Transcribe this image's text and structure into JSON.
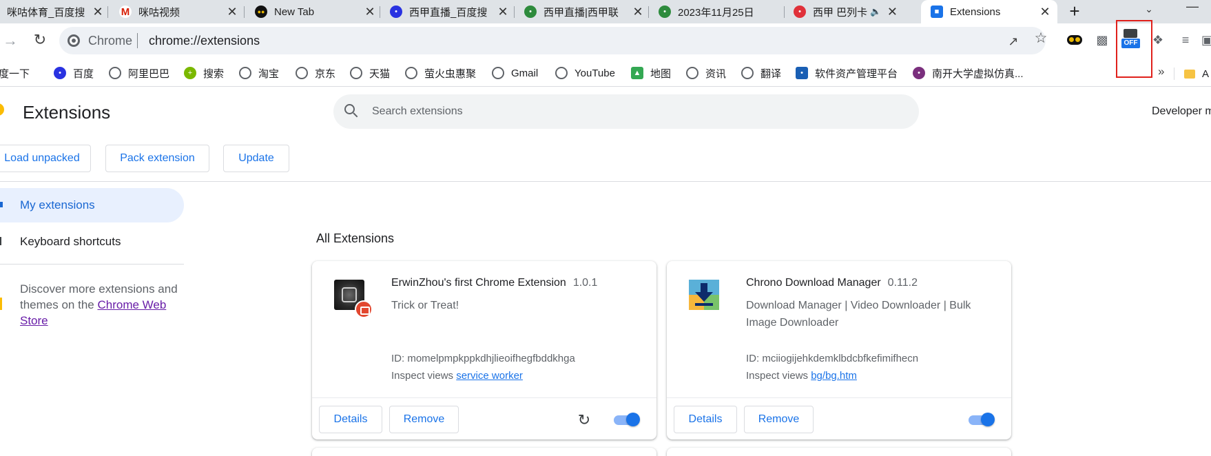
{
  "tabs": [
    {
      "title": "咪咕体育_百度搜",
      "favicon": "baidu-icon",
      "color": "#2932e1",
      "active": false
    },
    {
      "title": "咪咕视频",
      "favicon": "migu-icon",
      "color": "#d81e06",
      "active": false
    },
    {
      "title": "New Tab",
      "favicon": "eyes-icon",
      "color": "#111111",
      "active": false
    },
    {
      "title": "西甲直播_百度搜",
      "favicon": "baidu-icon",
      "color": "#2932e1",
      "active": false
    },
    {
      "title": "西甲直播|西甲联",
      "favicon": "site-icon",
      "color": "#2e8b3d",
      "active": false
    },
    {
      "title": "2023年11月25日",
      "favicon": "site-icon",
      "color": "#2e8b3d",
      "active": false
    },
    {
      "title": "西甲 巴列卡",
      "favicon": "site-icon",
      "color": "#e0313a",
      "active": false
    },
    {
      "title": "Extensions",
      "favicon": "puzzle-icon",
      "color": "#1a73e8",
      "active": true
    }
  ],
  "omnibox": {
    "site_label": "Chrome",
    "url": "chrome://extensions"
  },
  "bookmarks": [
    {
      "label": "百度一下",
      "icon": "site-icon"
    },
    {
      "label": "百度",
      "icon": "baidu-icon"
    },
    {
      "label": "阿里巴巴",
      "icon": "globe-icon"
    },
    {
      "label": "搜索",
      "icon": "site-icon"
    },
    {
      "label": "淘宝",
      "icon": "globe-icon"
    },
    {
      "label": "京东",
      "icon": "globe-icon"
    },
    {
      "label": "天猫",
      "icon": "globe-icon"
    },
    {
      "label": "萤火虫惠聚",
      "icon": "globe-icon"
    },
    {
      "label": "Gmail",
      "icon": "globe-icon"
    },
    {
      "label": "YouTube",
      "icon": "globe-icon"
    },
    {
      "label": "地图",
      "icon": "maps-icon"
    },
    {
      "label": "资讯",
      "icon": "globe-icon"
    },
    {
      "label": "翻译",
      "icon": "globe-icon"
    },
    {
      "label": "软件资产管理平台",
      "icon": "site-icon"
    },
    {
      "label": "南开大学虚拟仿真...",
      "icon": "site-icon"
    }
  ],
  "bookmarks_folder": "A",
  "toolbar_extension_badge": "OFF",
  "page": {
    "title": "Extensions",
    "search_placeholder": "Search extensions",
    "developer_mode_label": "Developer mode",
    "buttons": {
      "load_unpacked": "Load unpacked",
      "pack_extension": "Pack extension",
      "update": "Update"
    }
  },
  "sidebar": {
    "my_extensions": "My extensions",
    "keyboard_shortcuts": "Keyboard shortcuts",
    "discover_prefix": "Discover more extensions and themes on the ",
    "discover_link": "Chrome Web Store"
  },
  "section_title": "All Extensions",
  "extensions": [
    {
      "name": "ErwinZhou's first Chrome Extension",
      "version": "1.0.1",
      "description": "Trick or Treat!",
      "id_line": "ID: momelpmpkppkdhjlieoifhegfbddkhga",
      "inspect_label": "Inspect views",
      "inspect_link": "service worker",
      "details": "Details",
      "remove": "Remove",
      "enabled": true
    },
    {
      "name": "Chrono Download Manager",
      "version": "0.11.2",
      "description": "Download Manager | Video Downloader | Bulk Image Downloader",
      "id_line": "ID: mciiogijehkdemklbdcbfkefimifhecn",
      "inspect_label": "Inspect views",
      "inspect_link": "bg/bg.htm",
      "details": "Details",
      "remove": "Remove",
      "enabled": true
    }
  ],
  "colors": {
    "accent": "#1a73e8",
    "highlight_box": "#e0201b",
    "nav_selected_bg": "#e8f0fe"
  }
}
